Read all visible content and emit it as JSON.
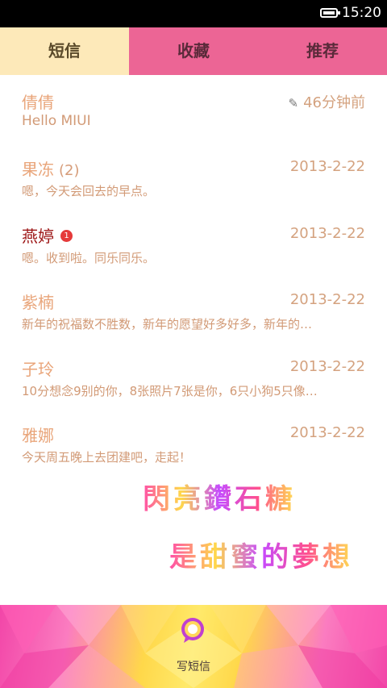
{
  "status_bar": {
    "time": "15:20"
  },
  "tabs": [
    {
      "label": "短信"
    },
    {
      "label": "收藏"
    },
    {
      "label": "推荐"
    }
  ],
  "conversations": [
    {
      "name": "倩倩",
      "count": "",
      "badge": "",
      "date": "46分钟前",
      "preview": "Hello MIUI"
    },
    {
      "name": "果冻",
      "count": "(2)",
      "badge": "",
      "date": "2013-2-22",
      "preview": "嗯，今天会回去的早点。"
    },
    {
      "name": "燕婷",
      "count": "",
      "badge": "1",
      "date": "2013-2-22",
      "preview": "嗯。收到啦。同乐同乐。"
    },
    {
      "name": "紫楠",
      "count": "",
      "badge": "",
      "date": "2013-2-22",
      "preview": "新年的祝福数不胜数，新年的愿望好多好多，新年的…"
    },
    {
      "name": "子玲",
      "count": "",
      "badge": "",
      "date": "2013-2-22",
      "preview": "10分想念9别的你，8张照片7张是你，6只小狗5只像…"
    },
    {
      "name": "雅娜",
      "count": "",
      "badge": "",
      "date": "2013-2-22",
      "preview": "今天周五晚上去团建吧，走起！"
    }
  ],
  "decoration": {
    "line1": "閃亮鑽石糖",
    "line2": "是甜蜜的夢想"
  },
  "footer": {
    "compose_label": "写短信",
    "compose_icon": "compose-message-icon"
  },
  "colors": {
    "tab_active": "#fde9b9",
    "tab_bar": "#ec6595",
    "name": "#e9a57a",
    "unread_name": "#9c1414",
    "badge": "#e53a3a"
  }
}
